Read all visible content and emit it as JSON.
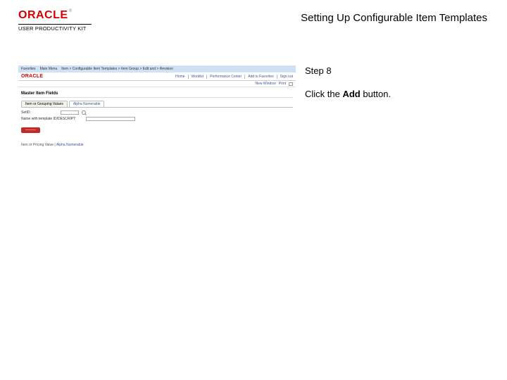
{
  "header": {
    "logo_brand": "ORACLE",
    "logo_tm": "®",
    "logo_sub": "USER PRODUCTIVITY KIT",
    "title": "Setting Up Configurable Item Templates"
  },
  "step": {
    "label": "Step 8",
    "pre": "Click the ",
    "bold": "Add",
    "post": " button."
  },
  "shot": {
    "bluebar": {
      "c0": "Favorites",
      "c1": "Main Menu",
      "c2": "Item  >  Configurable Item  Templates  >  Item Group  >  Edit  and  >  Revision"
    },
    "brand": "ORACLE",
    "nav": {
      "a": "Home",
      "b": "Worklist",
      "c": "Performance Center",
      "d": "Add to Favorites",
      "e": "Sign out"
    },
    "row3": {
      "a": "New Window",
      "b": "Print"
    },
    "heading": "Master Item Fields",
    "tab1": "Item or Grouping Values",
    "tab2": "Alpha Numerable",
    "field1_label": "SetID:",
    "field2_label": "Name with template ID/DESCRIPT:",
    "badge": "———",
    "footer_pre": "Item or Pricing Value  |  ",
    "footer_link": "Alpha Numerable"
  }
}
